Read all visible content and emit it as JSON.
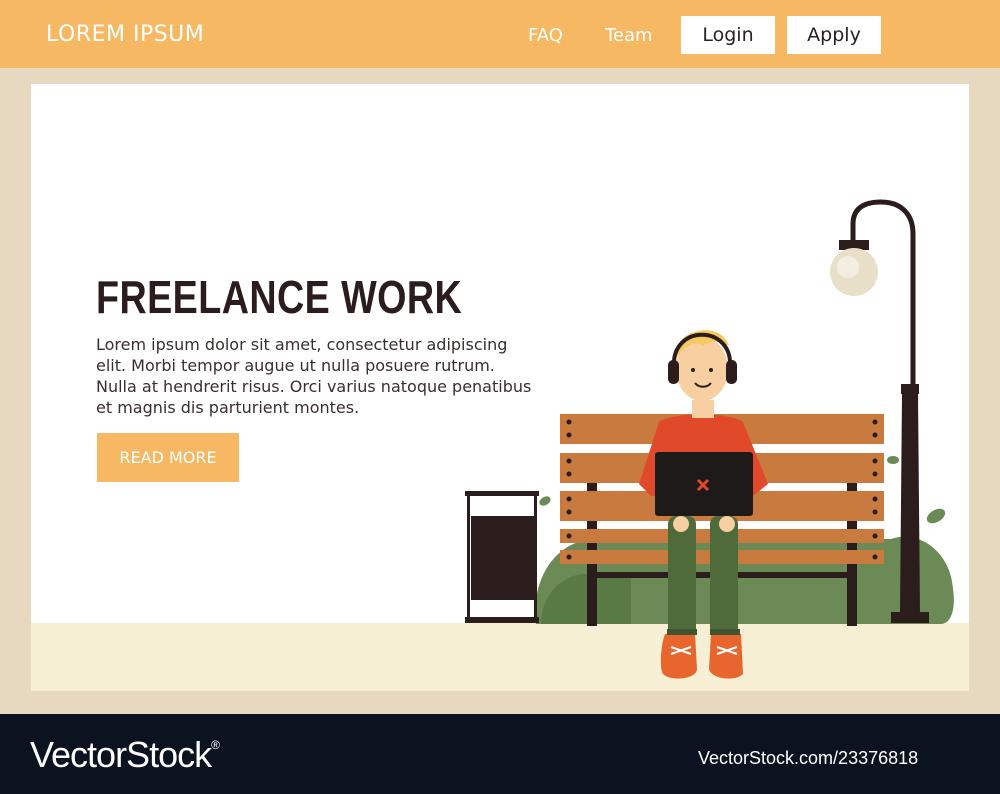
{
  "header": {
    "brand": "LOREM IPSUM",
    "nav": {
      "faq": "FAQ",
      "team": "Team"
    },
    "login_label": "Login",
    "apply_label": "Apply"
  },
  "hero": {
    "title": "FREELANCE WORK",
    "body": "Lorem ipsum dolor sit amet, consectetur adipiscing elit. Morbi tempor augue ut nulla posuere rutrum. Nulla at hendrerit risus. Orci varius natoque penatibus et magnis dis parturient montes.",
    "cta_label": "READ MORE"
  },
  "watermark": {
    "brand": "VectorStock",
    "registered": "®",
    "url": "VectorStock.com/23376818"
  },
  "colors": {
    "accent": "#f6b862",
    "frame": "#e7d9bf",
    "footer": "#0c1320",
    "heading": "#2b1d1d",
    "bench": "#c97a3e",
    "shirt": "#e04a2a",
    "pants": "#4f6b3a"
  },
  "illustration": {
    "subject": "young man with headphones sitting on a park bench using a laptop",
    "icons": [
      "bench-icon",
      "street-lamp-icon",
      "trash-bin-icon",
      "bush-icon",
      "laptop-icon",
      "headphones-icon"
    ]
  }
}
